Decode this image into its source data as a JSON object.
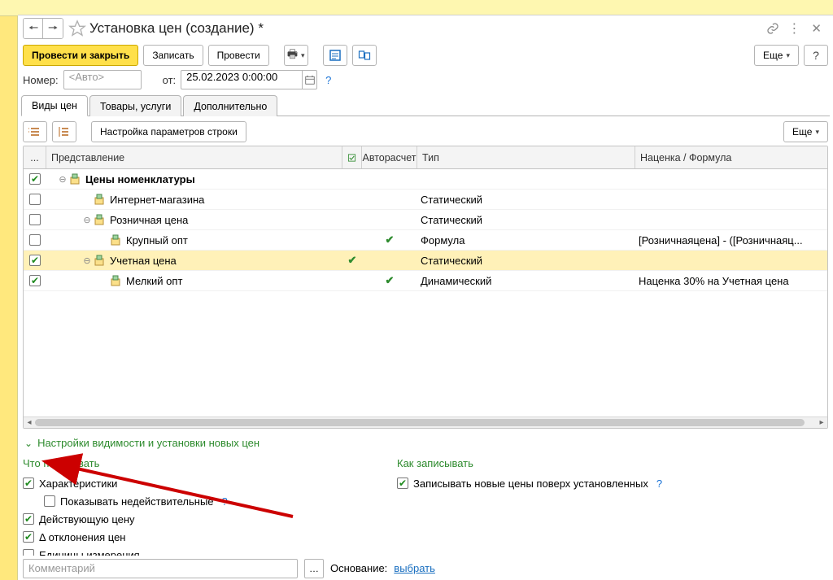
{
  "header": {
    "title": "Установка цен (создание) *"
  },
  "toolbar": {
    "post_close": "Провести и закрыть",
    "save": "Записать",
    "post": "Провести",
    "more": "Еще"
  },
  "form": {
    "number_label": "Номер:",
    "number_placeholder": "<Авто>",
    "from_label": "от:",
    "date_value": "25.02.2023  0:00:00"
  },
  "tabs": {
    "prices": "Виды цен",
    "goods": "Товары, услуги",
    "extra": "Дополнительно"
  },
  "subtoolbar": {
    "row_settings": "Настройка параметров строки",
    "more": "Еще"
  },
  "grid": {
    "headers": {
      "unused": "...",
      "name": "Представление",
      "auto": "Авторасчет",
      "type": "Тип",
      "markup": "Наценка / Формула"
    },
    "rows": [
      {
        "checked": true,
        "level": 1,
        "toggle": "minus",
        "name": "Цены номенклатуры",
        "bold": true,
        "cfg": "",
        "auto": "",
        "type": "",
        "markup": ""
      },
      {
        "checked": false,
        "level": 2,
        "name": "Интернет-магазина",
        "cfg": "",
        "auto": "",
        "type": "Статический",
        "markup": ""
      },
      {
        "checked": false,
        "level": 2,
        "toggle": "minus",
        "name": "Розничная цена",
        "cfg": "",
        "auto": "",
        "type": "Статический",
        "markup": ""
      },
      {
        "checked": false,
        "level": 3,
        "name": "Крупный опт",
        "cfg": "",
        "auto": "✔",
        "type": "Формула",
        "markup": "[Розничнаяцена] - ([Розничнаяц..."
      },
      {
        "checked": true,
        "level": 2,
        "toggle": "minus",
        "name": "Учетная цена",
        "cfg": "✔",
        "auto": "",
        "type": "Статический",
        "markup": "",
        "selected": true
      },
      {
        "checked": true,
        "level": 3,
        "name": "Мелкий опт",
        "cfg": "",
        "auto": "✔",
        "type": "Динамический",
        "markup": "Наценка 30% на Учетная цена"
      }
    ]
  },
  "collapsible": {
    "title": "Настройки видимости и установки новых цен"
  },
  "left_section": {
    "head": "Что показывать",
    "opt_characteristics": "Характеристики",
    "opt_show_invalid": "Показывать недействительные",
    "opt_current_price": "Действующую цену",
    "opt_delta": "Δ отклонения цен",
    "opt_uom": "Единицы измерения"
  },
  "right_section": {
    "head": "Как записывать",
    "opt_overwrite": "Записывать новые цены поверх установленных"
  },
  "footer": {
    "comment_placeholder": "Комментарий",
    "base_label": "Основание:",
    "base_link": "выбрать"
  }
}
